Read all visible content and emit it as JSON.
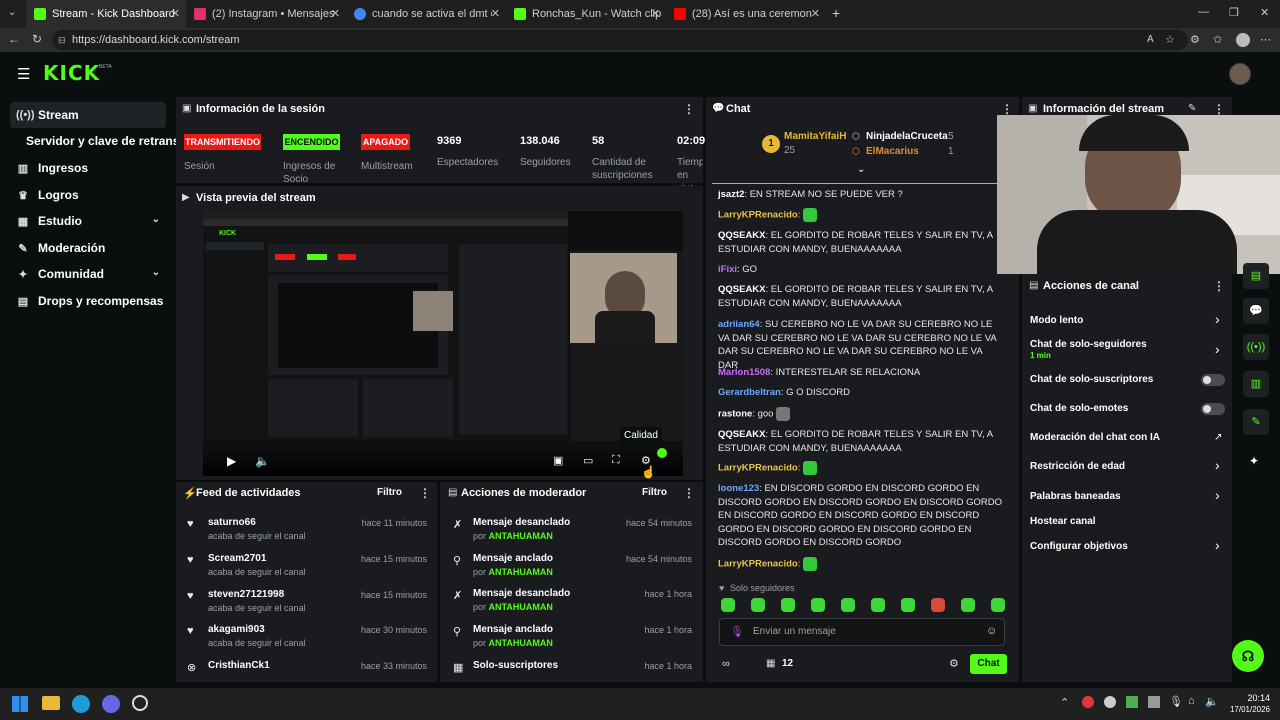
{
  "browser": {
    "tabs": [
      {
        "label": "Stream - Kick Dashboard",
        "color": "#53fc18",
        "active": true
      },
      {
        "label": "(2) Instagram • Mensajes",
        "color": "#e1306c"
      },
      {
        "label": "cuando se activa el dmt en el hum",
        "color": "#4285f4"
      },
      {
        "label": "Ronchas_Kun - Watch clips on Kick",
        "color": "#53fc18"
      },
      {
        "label": "(28) Así es una ceremonia de ayah",
        "color": "#ff0000"
      }
    ],
    "url": "https://dashboard.kick.com/stream"
  },
  "sidebar": {
    "items": [
      {
        "label": "Stream",
        "icon": "stream-icon"
      },
      {
        "label": "Servidor y clave de retransmisión",
        "icon": ""
      },
      {
        "label": "Ingresos",
        "icon": "chart-icon"
      },
      {
        "label": "Logros",
        "icon": "trophy-icon"
      },
      {
        "label": "Estudio",
        "icon": "studio-icon"
      },
      {
        "label": "Moderación",
        "icon": "wrench-icon"
      },
      {
        "label": "Comunidad",
        "icon": "community-icon"
      },
      {
        "label": "Drops y recompensas",
        "icon": "drops-icon"
      }
    ]
  },
  "session": {
    "title": "Información de la sesión",
    "badges": [
      {
        "text": "TRANSMITIENDO",
        "label": "Sesión",
        "color": "#e91916"
      },
      {
        "text": "ENCENDIDO",
        "label": "Ingresos de Socio",
        "color": "#53fc18"
      },
      {
        "text": "APAGADO",
        "label": "Multistream",
        "color": "#e91916"
      }
    ],
    "stats": [
      {
        "value": "9369",
        "label": "Espectadores"
      },
      {
        "value": "138.046",
        "label": "Seguidores"
      },
      {
        "value": "58",
        "label": "Cantidad de suscripciones"
      },
      {
        "value": "02:09",
        "label": "Tiempo en vivo"
      }
    ]
  },
  "preview": {
    "title": "Vista previa del stream",
    "tooltip": "Calidad"
  },
  "feed": {
    "title": "Feed de actividades",
    "filter": "Filtro",
    "rows": [
      {
        "name": "saturno66",
        "sub": "acaba de seguir el canal",
        "time": "hace 11 minutos",
        "icon": "heart-icon"
      },
      {
        "name": "Scream2701",
        "sub": "acaba de seguir el canal",
        "time": "hace 15 minutos",
        "icon": "heart-icon"
      },
      {
        "name": "steven27121998",
        "sub": "acaba de seguir el canal",
        "time": "hace 15 minutos",
        "icon": "heart-icon"
      },
      {
        "name": "akagami903",
        "sub": "acaba de seguir el canal",
        "time": "hace 30 minutos",
        "icon": "heart-icon"
      },
      {
        "name": "CristhianCk1",
        "sub": "",
        "time": "hace 33 minutos",
        "icon": "kick-icon"
      }
    ]
  },
  "modactions": {
    "title": "Acciones de moderador",
    "filter": "Filtro",
    "rows": [
      {
        "action": "Mensaje desanclado",
        "by": "por",
        "mod": "ANTAHUAMAN",
        "time": "hace 54 minutos",
        "icon": "unpin-icon"
      },
      {
        "action": "Mensaje anclado",
        "by": "por",
        "mod": "ANTAHUAMAN",
        "time": "hace 54 minutos",
        "icon": "pin-icon"
      },
      {
        "action": "Mensaje desanclado",
        "by": "por",
        "mod": "ANTAHUAMAN",
        "time": "hace 1 hora",
        "icon": "unpin-icon"
      },
      {
        "action": "Mensaje anclado",
        "by": "por",
        "mod": "ANTAHUAMAN",
        "time": "hace 1 hora",
        "icon": "pin-icon"
      },
      {
        "action": "Solo-suscriptores",
        "by": "",
        "mod": "",
        "time": "hace 1 hora",
        "icon": "gift-icon"
      }
    ]
  },
  "chat": {
    "title": "Chat",
    "top": [
      {
        "name": "MamitaYifaiH",
        "count": "25"
      },
      {
        "name": "NinjadelaCruceta",
        "count": "5"
      },
      {
        "name": "ElMacarius",
        "count": "1"
      }
    ],
    "rank": "1",
    "messages": [
      {
        "user": "jsazt2",
        "color": "#ffffff",
        "text": "EN STREAM NO SE PUEDE VER ?"
      },
      {
        "user": "LarryKPRenacido",
        "color": "#e8c34a",
        "text": ""
      },
      {
        "user": "QQSEAKX",
        "color": "#ffffff",
        "text": "EL GORDITO DE ROBAR TELES Y SALIR EN TV, A ESTUDIAR CON MANDY, BUENAAAAAAA"
      },
      {
        "user": "iFixi",
        "color": "#c86cff",
        "text": "GO"
      },
      {
        "user": "QQSEAKX",
        "color": "#ffffff",
        "text": "EL GORDITO DE ROBAR TELES Y SALIR EN TV, A ESTUDIAR CON MANDY, BUENAAAAAAA"
      },
      {
        "user": "adriian64",
        "color": "#6ea8ff",
        "text": "SU CEREBRO NO LE VA DAR SU CEREBRO NO LE VA DAR SU CEREBRO NO LE VA DAR SU CEREBRO NO LE VA DAR SU CEREBRO NO LE VA DAR SU CEREBRO NO LE VA DAR"
      },
      {
        "user": "Marlon1508",
        "color": "#c86cff",
        "text": "INTERESTELAR SE RELACIONA"
      },
      {
        "user": "Gerardbeltran",
        "color": "#6ea8ff",
        "text": "G O DISCORD"
      },
      {
        "user": "rastone",
        "color": "#ffffff",
        "text": "goo"
      },
      {
        "user": "QQSEAKX",
        "color": "#ffffff",
        "text": "EL GORDITO DE ROBAR TELES Y SALIR EN TV, A ESTUDIAR CON MANDY, BUENAAAAAAA"
      },
      {
        "user": "LarryKPRenacido",
        "color": "#e8c34a",
        "text": ""
      },
      {
        "user": "loone123",
        "color": "#6ea8ff",
        "text": "EN DISCORD GORDO EN DISCORD GORDO EN DISCORD GORDO EN DISCORD GORDO EN DISCORD GORDO EN DISCORD GORDO EN DISCORD GORDO EN DISCORD GORDO EN DISCORD GORDO EN DISCORD GORDO EN DISCORD GORDO EN DISCORD GORDO"
      },
      {
        "user": "LarryKPRenacido",
        "color": "#e8c34a",
        "text": ""
      }
    ],
    "followers_only": "Solo seguidores",
    "placeholder": "Enviar un mensaje",
    "viewers": "12",
    "send": "Chat"
  },
  "streaminfo": {
    "title": "Información del stream",
    "actions_title": "Acciones de canal",
    "rows": [
      {
        "label": "Modo lento",
        "sub": "",
        "control": "arrow"
      },
      {
        "label": "Chat de solo-seguidores",
        "sub": "1 min",
        "control": "arrow"
      },
      {
        "label": "Chat de solo-suscriptores",
        "sub": "",
        "control": "toggle"
      },
      {
        "label": "Chat de solo-emotes",
        "sub": "",
        "control": "toggle"
      },
      {
        "label": "Moderación del chat con IA",
        "sub": "",
        "control": "external"
      },
      {
        "label": "Restricción de edad",
        "sub": "",
        "control": "arrow"
      },
      {
        "label": "Palabras baneadas",
        "sub": "",
        "control": "arrow"
      },
      {
        "label": "Hostear canal",
        "sub": "",
        "control": "none"
      },
      {
        "label": "Configurar objetivos",
        "sub": "",
        "control": "arrow"
      }
    ]
  },
  "taskbar": {
    "time": "20:14",
    "date": "17/01/2026"
  }
}
